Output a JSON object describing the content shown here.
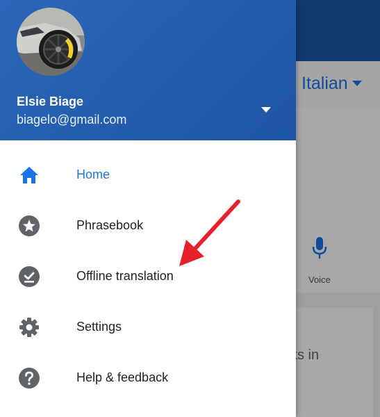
{
  "user": {
    "name": "Elsie Biage",
    "email": "biagelo@gmail.com"
  },
  "menu": {
    "items": [
      {
        "label": "Home",
        "icon": "home-icon",
        "active": true
      },
      {
        "label": "Phrasebook",
        "icon": "star-icon",
        "active": false
      },
      {
        "label": "Offline translation",
        "icon": "offline-download-icon",
        "active": false
      },
      {
        "label": "Settings",
        "icon": "gear-icon",
        "active": false
      },
      {
        "label": "Help & feedback",
        "icon": "help-icon",
        "active": false
      }
    ]
  },
  "background": {
    "target_language": "Italian",
    "voice_label": "Voice",
    "card_text_fragment": "ks in"
  },
  "colors": {
    "header": "#1e55a5",
    "accent": "#1a73e8",
    "arrow": "#e8202a",
    "icon": "#5f6368"
  }
}
